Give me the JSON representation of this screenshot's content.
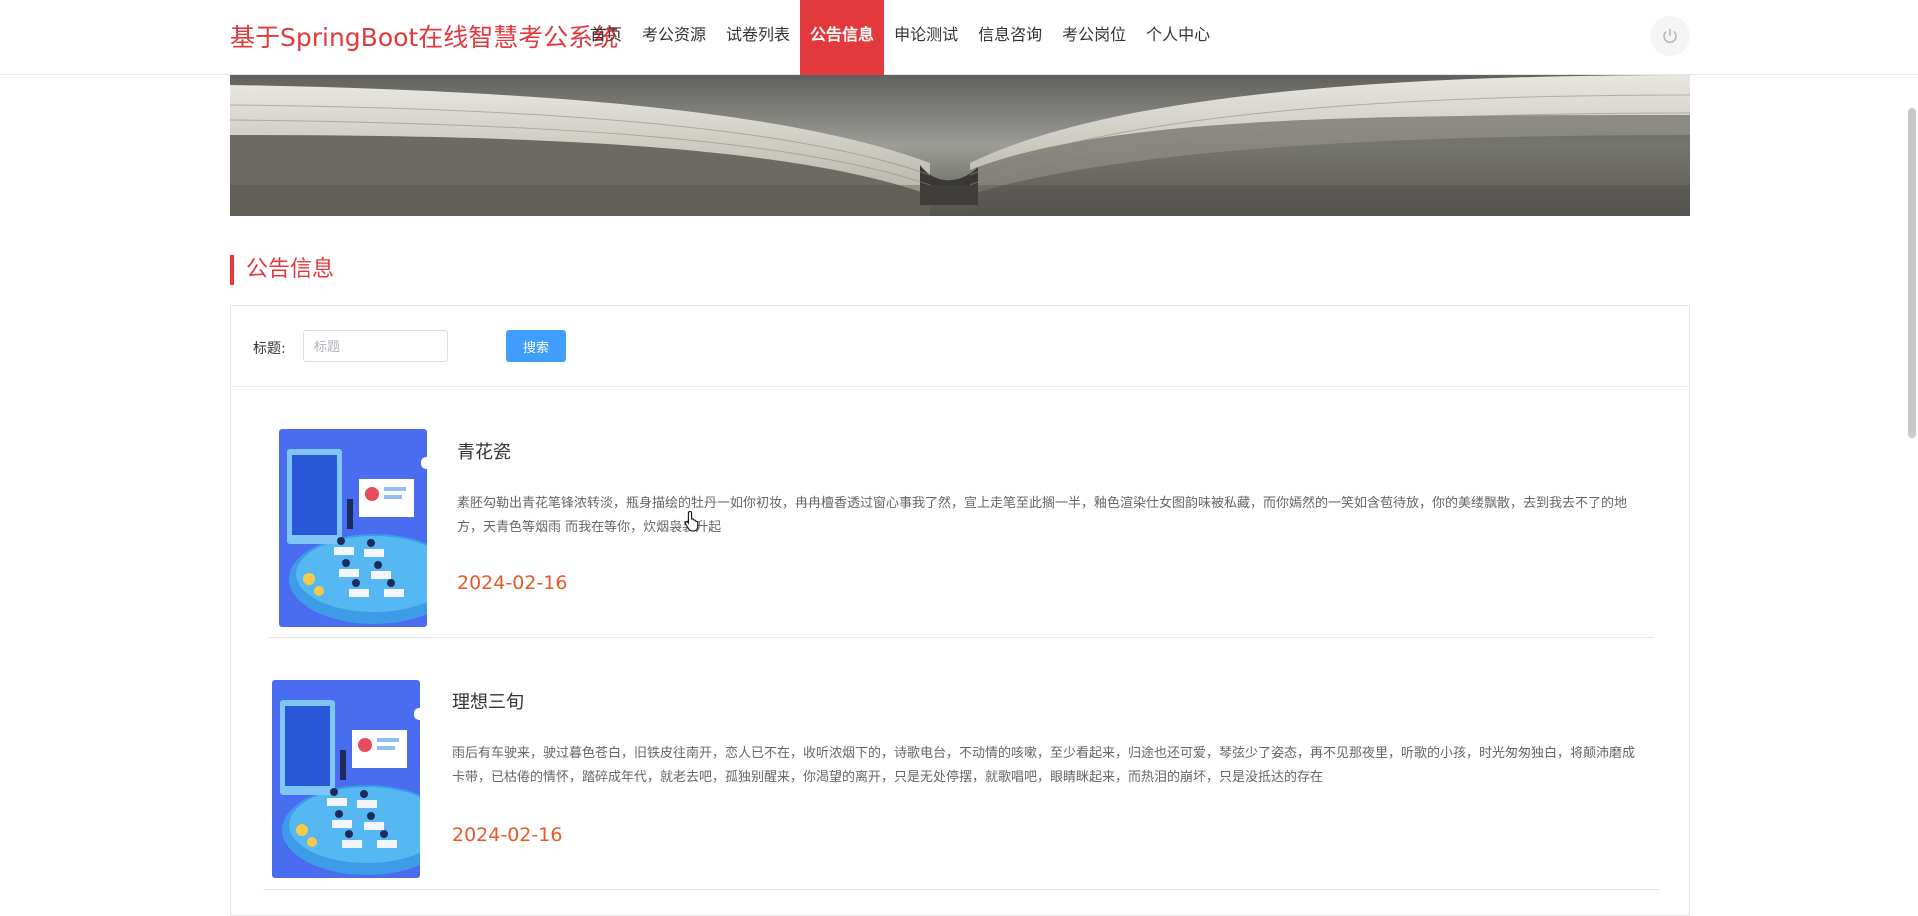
{
  "header": {
    "brand": "基于SpringBoot在线智慧考公系统",
    "nav": [
      {
        "label": "首页",
        "active": false
      },
      {
        "label": "考公资源",
        "active": false
      },
      {
        "label": "试卷列表",
        "active": false
      },
      {
        "label": "公告信息",
        "active": true
      },
      {
        "label": "申论测试",
        "active": false
      },
      {
        "label": "信息咨询",
        "active": false
      },
      {
        "label": "考公岗位",
        "active": false
      },
      {
        "label": "个人中心",
        "active": false
      }
    ],
    "power_icon": "power-icon"
  },
  "section": {
    "title": "公告信息"
  },
  "search": {
    "label": "标题:",
    "placeholder": "标题",
    "value": "",
    "button": "搜索"
  },
  "items": [
    {
      "title": "青花瓷",
      "desc": "素胚勾勒出青花笔锋浓转淡，瓶身描绘的牡丹一如你初妆，冉冉檀香透过窗心事我了然，宣上走笔至此搁一半，釉色渲染仕女图韵味被私藏，而你嫣然的一笑如含苞待放，你的美缕飘散，去到我去不了的地方，天青色等烟雨 而我在等你，炊烟袅袅升起",
      "date": "2024-02-16"
    },
    {
      "title": "理想三旬",
      "desc": "雨后有车驶来，驶过暮色苍白，旧铁皮往南开，恋人已不在，收听浓烟下的，诗歌电台，不动情的咳嗽，至少看起来，归途也还可爱，琴弦少了姿态，再不见那夜里，听歌的小孩，时光匆匆独白，将颠沛磨成卡带，已枯倦的情怀，踏碎成年代，就老去吧，孤独别醒来，你渴望的离开，只是无处停摆，就歌唱吧，眼睛眯起来，而热泪的崩坏，只是没抵达的存在",
      "date": "2024-02-16"
    }
  ],
  "colors": {
    "accent": "#e4393c",
    "button": "#409eff",
    "date": "#e65a2a"
  }
}
